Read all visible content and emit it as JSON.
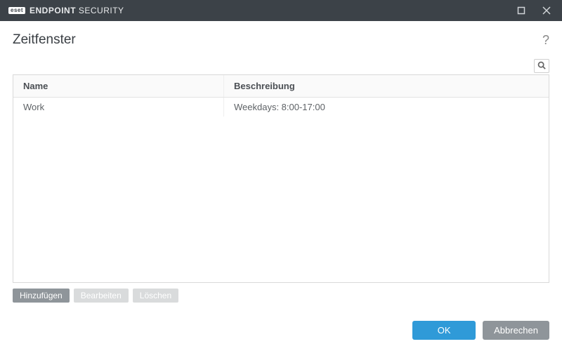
{
  "titlebar": {
    "badge": "eset",
    "product_strong": "ENDPOINT",
    "product_light": " SECURITY"
  },
  "page": {
    "title": "Zeitfenster",
    "help": "?"
  },
  "table": {
    "headers": {
      "name": "Name",
      "desc": "Beschreibung"
    },
    "rows": [
      {
        "name": "Work",
        "desc": "Weekdays: 8:00-17:00"
      }
    ]
  },
  "actions": {
    "add": "Hinzufügen",
    "edit": "Bearbeiten",
    "delete": "Löschen"
  },
  "footer": {
    "ok": "OK",
    "cancel": "Abbrechen"
  }
}
